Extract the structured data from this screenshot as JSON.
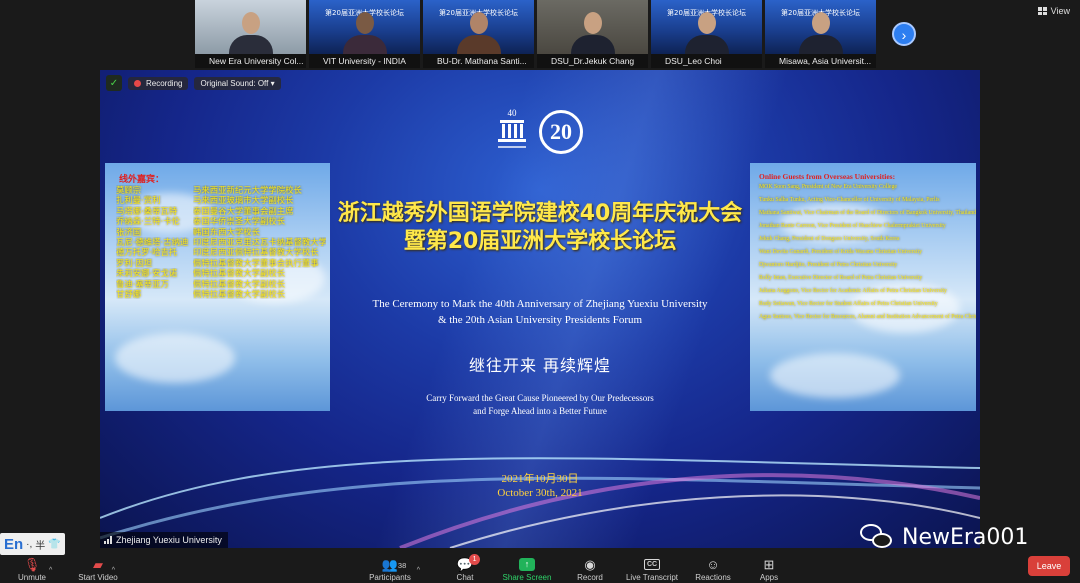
{
  "thumbnails": [
    {
      "name": "New Era University Col...",
      "style": "office"
    },
    {
      "name": "VIT University - INDIA",
      "style": "banner",
      "banner_text": "第20届亚洲大学校长论坛"
    },
    {
      "name": "BU-Dr. Mathana Santi...",
      "style": "banner",
      "banner_text": "第20届亚洲大学校长论坛"
    },
    {
      "name": "DSU_Dr.Jekuk Chang",
      "style": "room"
    },
    {
      "name": "DSU_Leo Choi",
      "style": "banner",
      "banner_text": "第20届亚洲大学校长论坛"
    },
    {
      "name": "Misawa, Asia Universit...",
      "style": "banner",
      "banner_text": "第20届亚洲大学校长论坛"
    }
  ],
  "top": {
    "view_label": "View",
    "next_arrow": "›"
  },
  "share": {
    "recording_label": "Recording",
    "original_sound": "Original Sound: Off",
    "logo_a_text": "40",
    "logo_b_text": "20",
    "headline_line1": "浙江越秀外国语学院建校40周年庆祝大会",
    "headline_line2": "暨第20届亚洲大学校长论坛",
    "en_title_line1": "The Ceremony to Mark the 40th Anniversary of Zhejiang Yuexiu University",
    "en_title_line2": "& the 20th Asian University Presidents Forum",
    "motto": "继往开来 再续辉煌",
    "motto_en_line1": "Carry Forward the Great Cause Pioneered by Our Predecessors",
    "motto_en_line2": "and Forge Ahead into a Better Future",
    "date_cn": "2021年10月30日",
    "date_en": "October 30th, 2021",
    "speaker": "Zhejiang Yuexiu University",
    "left_panel": {
      "heading": "线外嘉宾：",
      "guests": [
        {
          "name": "莫顾宗",
          "role": "马来西亚新纪元大学学院校长"
        },
        {
          "name": "扎利曼·赏利",
          "role": "马来西亚玻璃市大学副校长"
        },
        {
          "name": "马塔娜·桑蒂瓦特",
          "role": "泰国曼谷大学董事会副主席"
        },
        {
          "name": "乔纳森·兰特·卡伦",
          "role": "泰国华侨崇圣大学副校长"
        },
        {
          "name": "张济国",
          "role": "韩国东西大学校长"
        },
        {
          "name": "瓦尼·德维塔·古纳迪",
          "role": "印度尼西亚克里达瓦卡纳基督教大学校长"
        },
        {
          "name": "德万托罗·哈吉托",
          "role": "印度尼西亚佩特拉基督教大学校长"
        },
        {
          "name": "罗利·因坦",
          "role": "佩特拉基督教大学董事会执行董事"
        },
        {
          "name": "朱莉安娜·安戈诺",
          "role": "佩特拉基督教大学副校长"
        },
        {
          "name": "鲁迪·塞蒂亚万",
          "role": "佩特拉基督教大学副校长"
        },
        {
          "name": "甘舒娜",
          "role": "佩特拉基督教大学副校长"
        }
      ]
    },
    "right_panel": {
      "heading": "Online Guests from Overseas Universities:",
      "guests": [
        "MOK Soon Sang, President of New Era University College",
        "Tunku Salha Tunku, Acting Vice-Chancellor of University of Malaysia, Perlis",
        "Mathana Santiwat, Vice Chairman of the Board of Directors of Bangkok University, Thailand",
        "Jonathan Rante Carreon, Vice President of Huachiew Chalermprakiet University",
        "Jekuk Chang, President of Dongseo University, South Korea",
        "Wani Devita Gunardi, President of Krida Wacana Christian University",
        "Djwantoro Hardjito, President of Petra Christian University",
        "Rolly Intan, Executive Director of Board of Petra Christian University",
        "Juliana Anggono, Vice Rector for Academic Affairs of Petra Christian University",
        "Rudy Setiawan, Vice Rector for Student Affairs of Petra Christian University",
        "Agus Santoso, Vice Rector for Resources, Alumni and Institution Advancement of Petra Christian University"
      ]
    }
  },
  "ime": {
    "lang": "En",
    "s1": "·,",
    "s2": "半",
    "s3": "👕"
  },
  "watermark": "NewEra001",
  "toolbar": {
    "unmute": "Unmute",
    "start_video": "Start Video",
    "participants": "Participants",
    "participants_count": "38",
    "chat": "Chat",
    "chat_badge": "1",
    "share_screen": "Share Screen",
    "record": "Record",
    "live_transcript": "Live Transcript",
    "reactions": "Reactions",
    "apps": "Apps",
    "leave": "Leave"
  },
  "colors": {
    "accent_green": "#21b35a",
    "leave_red": "#d9403a",
    "headline_yellow": "#ffe84a"
  }
}
